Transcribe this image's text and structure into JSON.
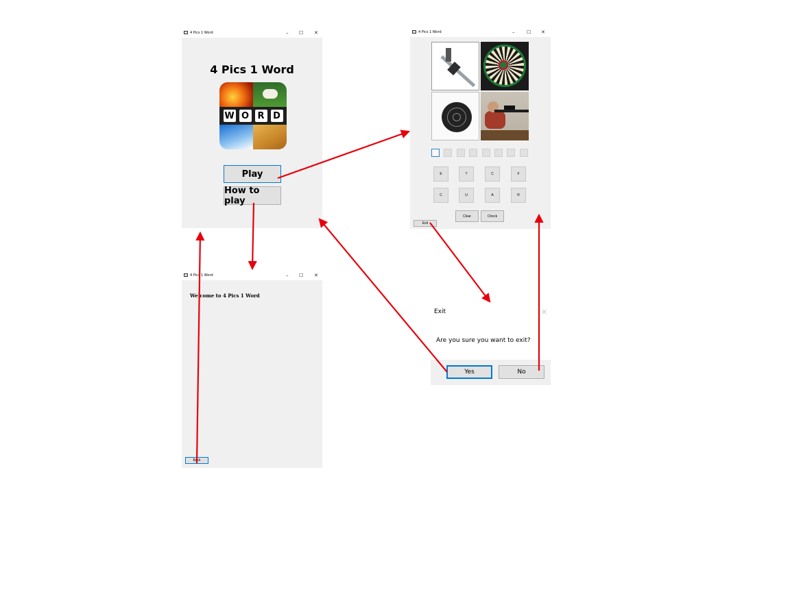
{
  "window_title": "4 Pics 1 Word",
  "window_controls": {
    "minimize": "–",
    "maximize": "☐",
    "close": "✕"
  },
  "main_menu": {
    "heading": "4 Pics 1 Word",
    "logo_letters": [
      "W",
      "O",
      "R",
      "D"
    ],
    "play_label": "Play",
    "how_to_play_label": "How to play"
  },
  "how_to_play": {
    "welcome_text": "Welcome to 4 Pics 1 Word",
    "back_label": "Back"
  },
  "game": {
    "pictures": [
      "caliper-icon",
      "dartboard-icon",
      "shooting-target-icon",
      "rifle-shooter-icon"
    ],
    "answer_slot_count": 8,
    "letters": [
      "E",
      "T",
      "C",
      "F",
      "C",
      "U",
      "A",
      "R"
    ],
    "clear_label": "Clear",
    "check_label": "Check",
    "exit_label": "Exit"
  },
  "exit_dialog": {
    "title": "Exit",
    "message": "Are you sure you want to exit?",
    "yes_label": "Yes",
    "no_label": "No"
  },
  "colors": {
    "arrow": "#e8000b",
    "focus": "#0078d7",
    "window_bg": "#f0f0f0"
  }
}
